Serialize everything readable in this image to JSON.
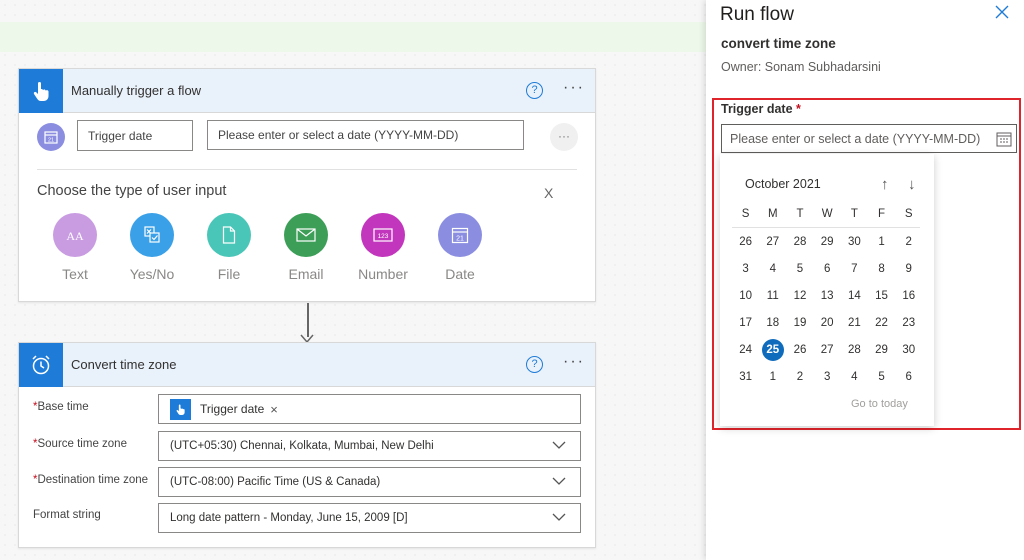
{
  "trigger_card": {
    "title": "Manually trigger a flow",
    "help": "?",
    "more": "···",
    "param_name": "Trigger date",
    "param_placeholder": "Please enter or select a date (YYYY-MM-DD)",
    "param_more": "···",
    "choose_title": "Choose the type of user input",
    "close": "X",
    "input_types": [
      {
        "label": "Text",
        "color": "#c99ce2",
        "icon": "text-icon"
      },
      {
        "label": "Yes/No",
        "color": "#3aa0e7",
        "icon": "yes-no-icon"
      },
      {
        "label": "File",
        "color": "#49c6b8",
        "icon": "file-icon"
      },
      {
        "label": "Email",
        "color": "#3d9e58",
        "icon": "email-icon"
      },
      {
        "label": "Number",
        "color": "#c236bd",
        "icon": "number-icon"
      },
      {
        "label": "Date",
        "color": "#8b8ee0",
        "icon": "calendar-icon"
      }
    ]
  },
  "convert_card": {
    "title": "Convert time zone",
    "help": "?",
    "more": "···",
    "fields": [
      {
        "label": "Base time",
        "required": "*",
        "token": "Trigger date",
        "token_remove": "×"
      },
      {
        "label": "Source time zone",
        "required": "*",
        "value": "(UTC+05:30) Chennai, Kolkata, Mumbai, New Delhi"
      },
      {
        "label": "Destination time zone",
        "required": "*",
        "value": "(UTC-08:00) Pacific Time (US & Canada)"
      },
      {
        "label": "Format string",
        "value": "Long date pattern - Monday, June 15, 2009 [D]"
      }
    ]
  },
  "panel": {
    "title": "Run flow",
    "flow_name": "convert time zone",
    "owner": "Owner: Sonam Subhadarsini",
    "trigger_label": "Trigger date",
    "required_mark": "*",
    "date_placeholder": "Please enter or select a date (YYYY-MM-DD)"
  },
  "calendar": {
    "month": "October 2021",
    "up_arrow": "↑",
    "down_arrow": "↓",
    "days_of_week": [
      "S",
      "M",
      "T",
      "W",
      "T",
      "F",
      "S"
    ],
    "weeks": [
      [
        "26",
        "27",
        "28",
        "29",
        "30",
        "1",
        "2"
      ],
      [
        "3",
        "4",
        "5",
        "6",
        "7",
        "8",
        "9"
      ],
      [
        "10",
        "11",
        "12",
        "13",
        "14",
        "15",
        "16"
      ],
      [
        "17",
        "18",
        "19",
        "20",
        "21",
        "22",
        "23"
      ],
      [
        "24",
        "25",
        "26",
        "27",
        "28",
        "29",
        "30"
      ],
      [
        "31",
        "1",
        "2",
        "3",
        "4",
        "5",
        "6"
      ]
    ],
    "selected": "25",
    "goto_today": "Go to today"
  },
  "colors": {
    "accent": "#1e7cd8",
    "selected_day": "#0f6cbd",
    "highlight_border": "#e0242b"
  }
}
